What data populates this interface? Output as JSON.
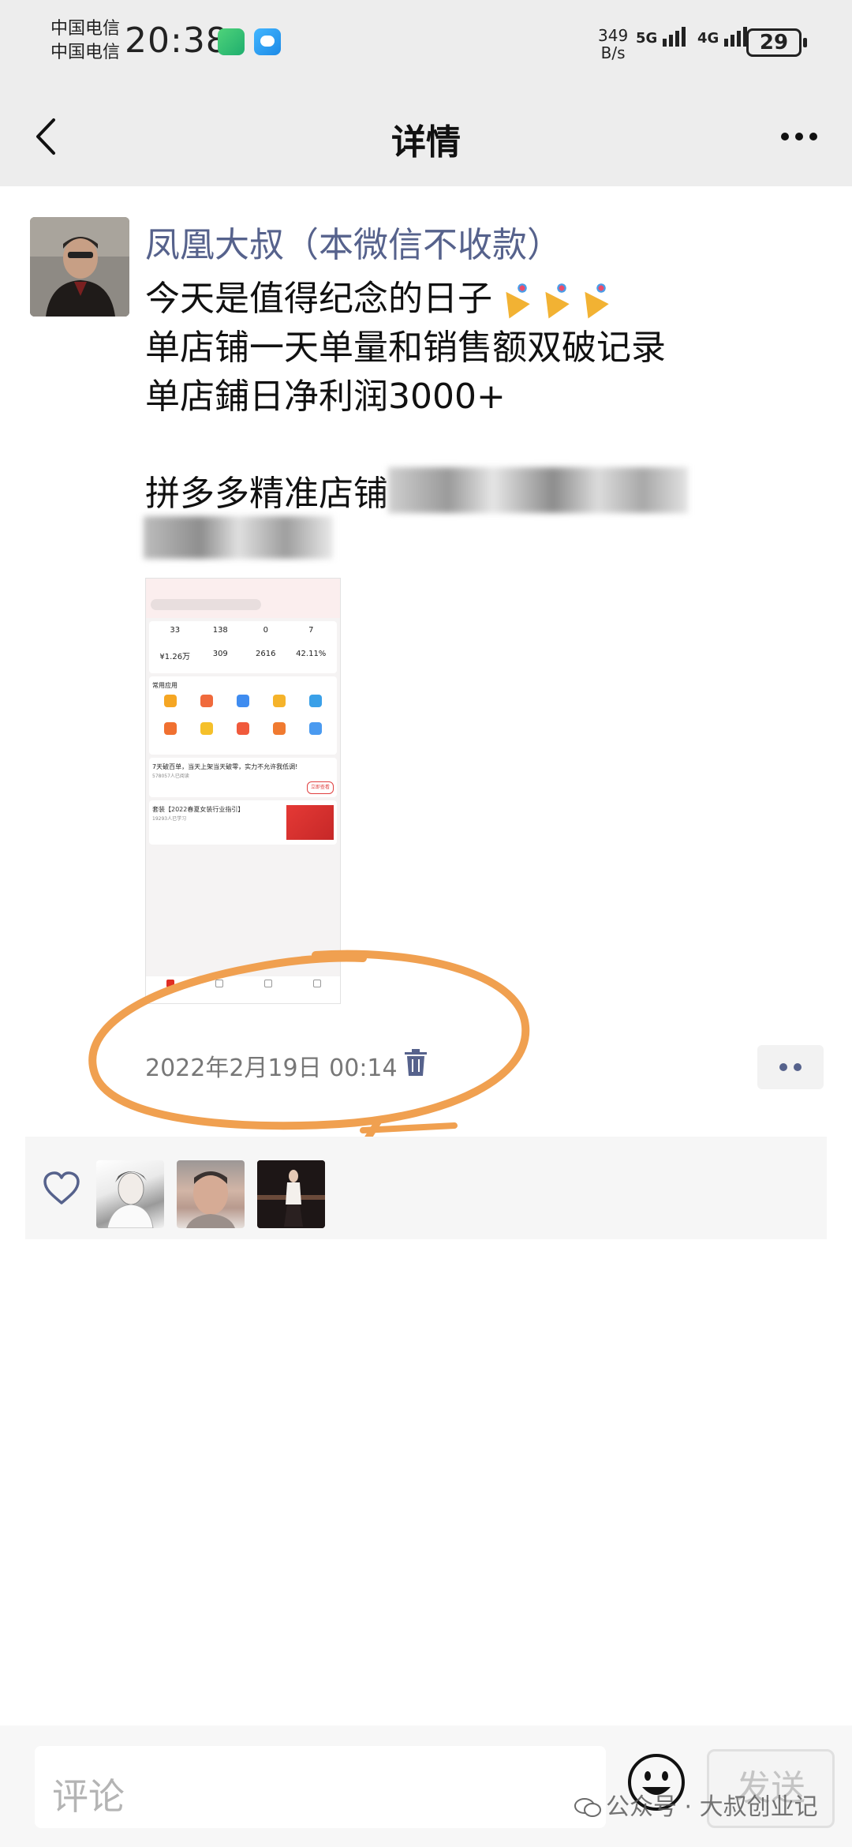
{
  "status_bar": {
    "carrier_1": "中国电信",
    "carrier_2": "中国电信",
    "time": "20:38",
    "net_speed_value": "349",
    "net_speed_unit": "B/s",
    "signal_1_tag": "5G",
    "signal_2_tag": "4G",
    "battery": "29"
  },
  "nav": {
    "title": "详情"
  },
  "post": {
    "author": "凤凰大叔（本微信不收款）",
    "lines": [
      "今天是值得纪念的日子",
      "单店铺一天单量和销售额双破记录",
      "单店鋪日净利润3000+",
      "拼多多精准店铺"
    ],
    "time": "2022年2月19日 00:14"
  },
  "embedded_screenshot": {
    "stats_row_1": [
      {
        "value": "33"
      },
      {
        "value": "138"
      },
      {
        "value": "0"
      },
      {
        "value": "7"
      }
    ],
    "stats_row_2": [
      {
        "value": "¥1.26万"
      },
      {
        "value": "309"
      },
      {
        "value": "2616"
      },
      {
        "value": "42.11%"
      }
    ],
    "apps_title": "常用应用",
    "news_title": "7天破百单，当天上架当天破零，实力不允许我低调!",
    "news_readers": "578057人已阅读",
    "news_button": "立即查看",
    "kit_title": "套装【2022春夏女装行业指引】",
    "kit_readers": "19293人已学习"
  },
  "comment_bar": {
    "placeholder": "评论",
    "send_label": "发送"
  },
  "watermark": "公众号 · 大叔创业记",
  "colors": {
    "author_name": "#56628c",
    "bar_background": "#ededed",
    "annotation": "#f0a050"
  }
}
